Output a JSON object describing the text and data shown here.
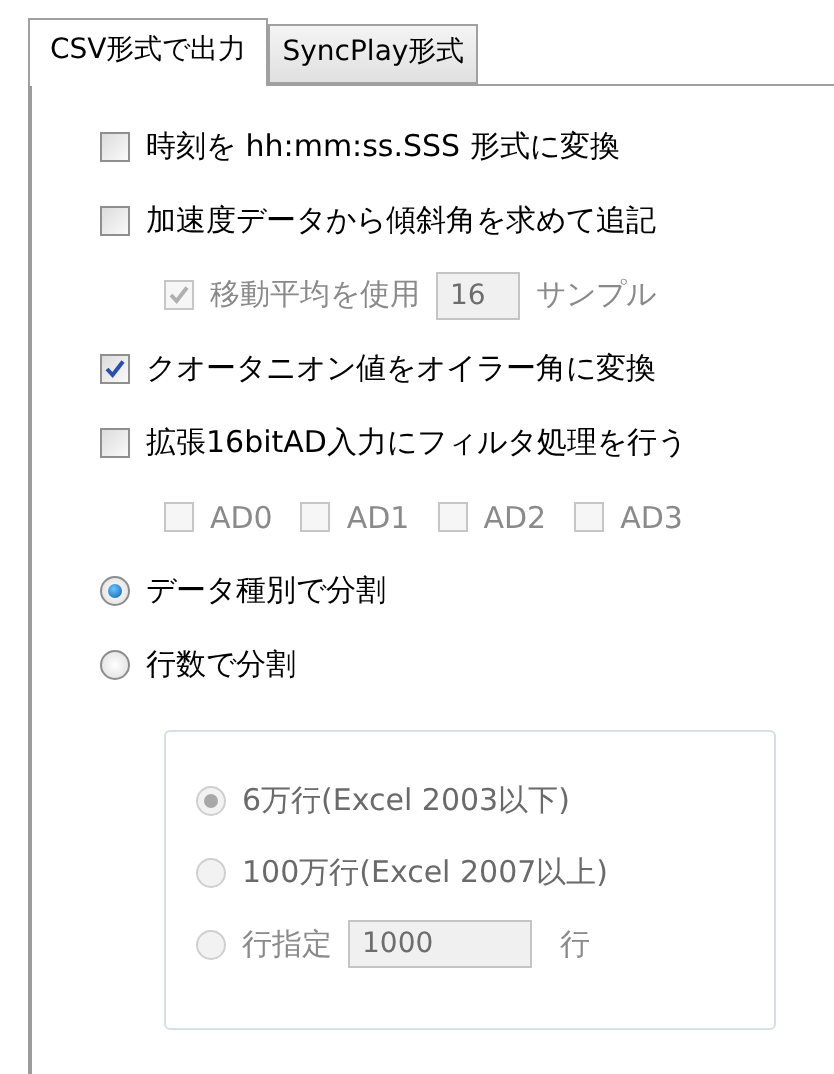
{
  "tabs": [
    {
      "label": "CSV形式で出力",
      "selected": true
    },
    {
      "label": "SyncPlay形式",
      "selected": false
    }
  ],
  "options": [
    {
      "label": "時刻を hh:mm:ss.SSS 形式に変換",
      "checked": false,
      "disabled": false
    },
    {
      "label": "加速度データから傾斜角を求めて追記",
      "checked": false,
      "disabled": false,
      "children": [
        {
          "label": "移動平均を使用",
          "checked": true,
          "disabled": true,
          "field": "16",
          "unit": "サンプル"
        }
      ]
    },
    {
      "label": "クオータニオン値をオイラー角に変換",
      "checked": true,
      "disabled": false
    },
    {
      "label": "拡張16bitAD入力にフィルタ処理を行う",
      "checked": false,
      "disabled": false,
      "channels": [
        {
          "label": "AD0",
          "checked": false,
          "disabled": true
        },
        {
          "label": "AD1",
          "checked": false,
          "disabled": true
        },
        {
          "label": "AD2",
          "checked": false,
          "disabled": true
        },
        {
          "label": "AD3",
          "checked": false,
          "disabled": true
        }
      ]
    }
  ],
  "split_modes": [
    {
      "label": "データ種別で分割",
      "selected": true
    },
    {
      "label": "行数で分割",
      "selected": false
    }
  ],
  "row_limit": {
    "disabled": true,
    "options": [
      {
        "label": "6万行(Excel 2003以下)",
        "selected": true
      },
      {
        "label": "100万行(Excel 2007以上)",
        "selected": false
      },
      {
        "label": "行指定",
        "selected": false,
        "field": "1000",
        "unit": "行"
      }
    ]
  }
}
